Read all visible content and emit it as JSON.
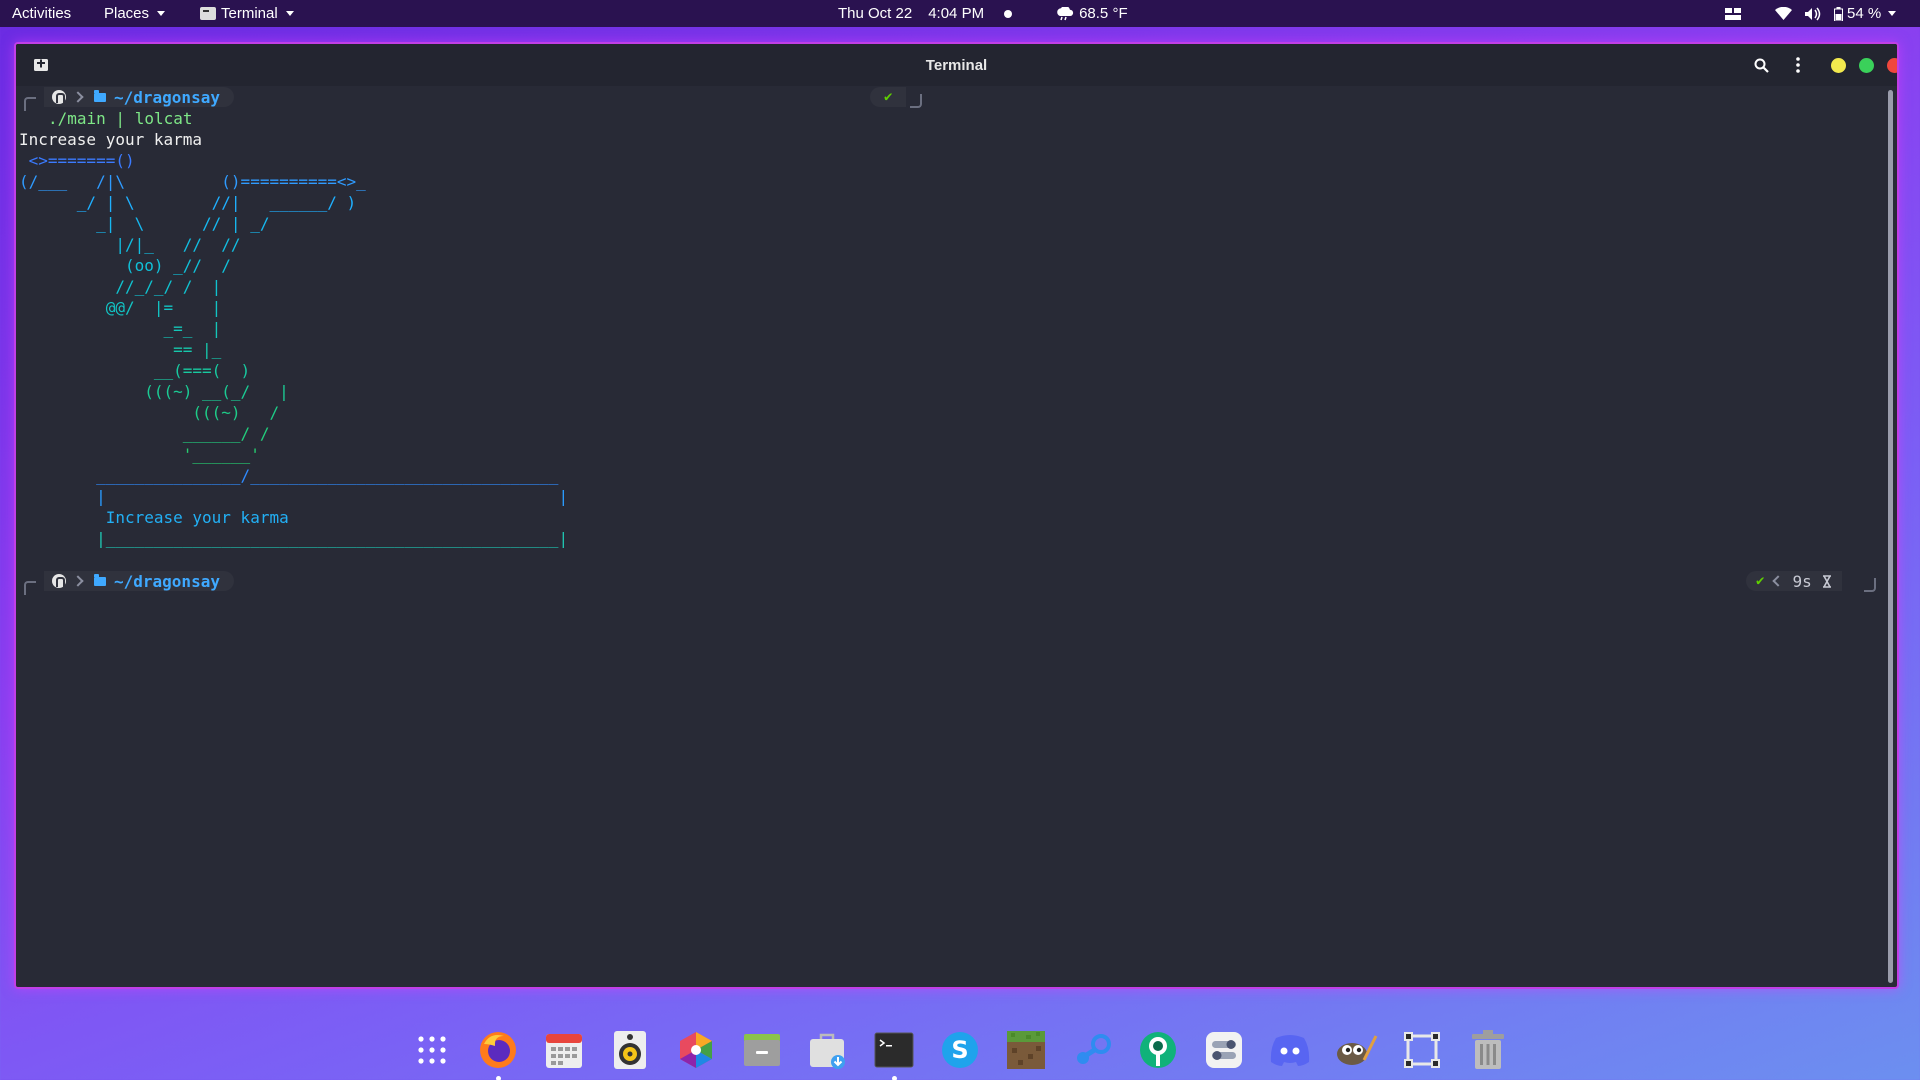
{
  "topbar": {
    "activities": "Activities",
    "places": "Places",
    "app_menu": "Terminal",
    "date": "Thu Oct 22",
    "time": "4:04 PM",
    "weather": "68.5 °F",
    "battery": "54 %"
  },
  "window": {
    "title": "Terminal"
  },
  "terminal": {
    "prompt1": {
      "path": "~/dragonsay",
      "status": "✔"
    },
    "command": "./main | lolcat",
    "output_text": "Increase your karma",
    "art": [
      {
        "text": " <>=======()",
        "color": "#3b7bff"
      },
      {
        "text": "(/___   /|\\          ()==========<>_",
        "color": "#2f9bff"
      },
      {
        "text": "      _/ | \\        //|   ______/ )",
        "color": "#1fb0ff"
      },
      {
        "text": "        _|  \\      // | _/",
        "color": "#16b8f0"
      },
      {
        "text": "          |/|_   //  //",
        "color": "#12bde0"
      },
      {
        "text": "           (oo) _//  /",
        "color": "#10c0d8"
      },
      {
        "text": "          //_/_/ /  |",
        "color": "#10c2cf"
      },
      {
        "text": "         @@/  |=    |",
        "color": "#12c4c4"
      },
      {
        "text": "               _=_  |",
        "color": "#14c6b8"
      },
      {
        "text": "                == |_",
        "color": "#16c8ac"
      },
      {
        "text": "              __(===(  )",
        "color": "#18c9a0"
      },
      {
        "text": "             (((~) __(_/   |",
        "color": "#1bcb94"
      },
      {
        "text": "                  (((~)   /",
        "color": "#1ecc88"
      },
      {
        "text": "                 ______/ /",
        "color": "#22cd7c"
      },
      {
        "text": "                 '______'",
        "color": "#26ce70"
      },
      {
        "text": "        _______________/________________________________",
        "color": "#2f8bff"
      },
      {
        "text": "        |                                               |",
        "color": "#2a9cff"
      },
      {
        "text": "         Increase your karma",
        "color": "#22b0f5"
      },
      {
        "text": "        |_______________________________________________|",
        "color": "#1fc4b0"
      }
    ],
    "prompt2": {
      "path": "~/dragonsay",
      "status": "✔",
      "duration": "9s",
      "duration_icon": "hourglass-icon"
    }
  },
  "dock": {
    "items": [
      {
        "name": "show-apps",
        "icon": "app-grid-icon"
      },
      {
        "name": "firefox",
        "icon": "firefox-icon",
        "running": true
      },
      {
        "name": "calendar",
        "icon": "calendar-icon"
      },
      {
        "name": "rhythmbox",
        "icon": "speaker-icon"
      },
      {
        "name": "photos",
        "icon": "photos-icon"
      },
      {
        "name": "files",
        "icon": "file-cabinet-icon"
      },
      {
        "name": "software",
        "icon": "software-bag-icon"
      },
      {
        "name": "terminal",
        "icon": "terminal-icon",
        "running": true
      },
      {
        "name": "skype",
        "icon": "skype-icon"
      },
      {
        "name": "minecraft",
        "icon": "minecraft-icon"
      },
      {
        "name": "steam",
        "icon": "steam-icon"
      },
      {
        "name": "krita",
        "icon": "paint-icon"
      },
      {
        "name": "gnome-tweaks",
        "icon": "toggles-icon"
      },
      {
        "name": "discord",
        "icon": "discord-icon"
      },
      {
        "name": "gimp",
        "icon": "gimp-icon"
      },
      {
        "name": "screenshot",
        "icon": "screenshot-icon"
      },
      {
        "name": "trash",
        "icon": "trash-icon"
      }
    ]
  },
  "colors": {
    "prompt_blue": "#3fa9ff",
    "command_green": "#7ee787",
    "window_border": "#c13fe6",
    "terminal_bg": "#282a36"
  }
}
